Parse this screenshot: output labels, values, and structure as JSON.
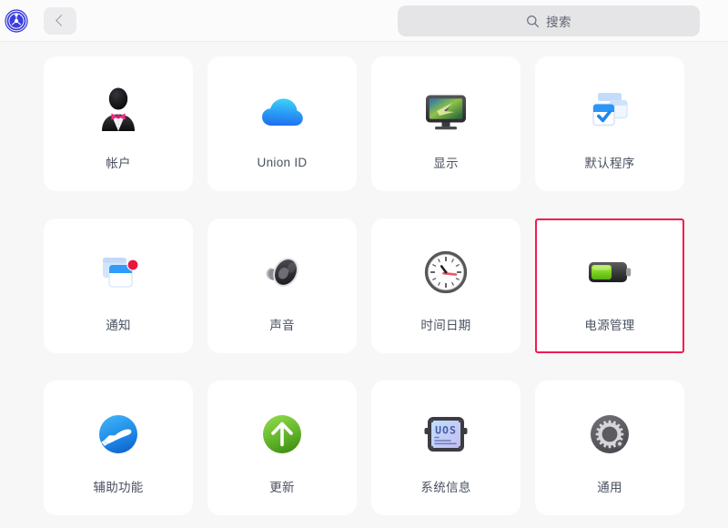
{
  "window": {
    "logo_icon": "control-center-gear-logo",
    "back_icon": "chevron-left-icon"
  },
  "search": {
    "icon": "search-icon",
    "placeholder": "搜索",
    "value": ""
  },
  "grid": {
    "selected_item": "电源管理",
    "highlight_color": "#f21a52",
    "items": [
      {
        "label": "帐户",
        "icon": "user-avatar-icon"
      },
      {
        "label": "Union ID",
        "icon": "cloud-icon"
      },
      {
        "label": "显示",
        "icon": "monitor-icon"
      },
      {
        "label": "默认程序",
        "icon": "default-apps-check-icon"
      },
      {
        "label": "通知",
        "icon": "notification-windows-badge-icon"
      },
      {
        "label": "声音",
        "icon": "speaker-icon"
      },
      {
        "label": "时间日期",
        "icon": "clock-icon"
      },
      {
        "label": "电源管理",
        "icon": "battery-icon"
      },
      {
        "label": "辅助功能",
        "icon": "accessibility-hand-icon"
      },
      {
        "label": "更新",
        "icon": "update-arrow-up-icon"
      },
      {
        "label": "系统信息",
        "icon": "system-info-chip-icon"
      },
      {
        "label": "通用",
        "icon": "general-gear-icon"
      }
    ]
  }
}
